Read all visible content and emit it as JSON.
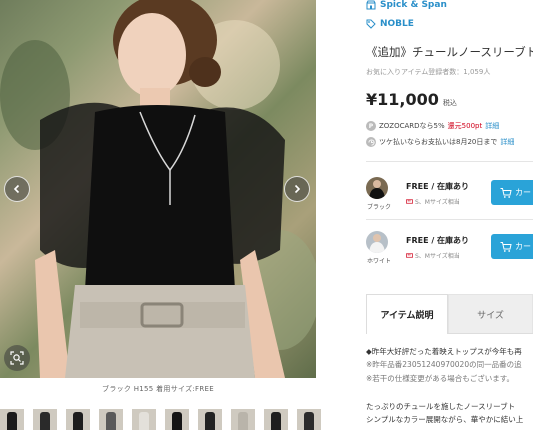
{
  "gallery": {
    "caption": "ブラック H155 着用サイズ:FREE",
    "thumb_count": 10,
    "thumb_colors": [
      "#1b1b1b",
      "#2a2a2a",
      "#1d1d1d",
      "#5a5a5a",
      "#e3e0da",
      "#151515",
      "#222222",
      "#b9b4aa",
      "#1e1e1e",
      "#2b2b2b"
    ]
  },
  "product": {
    "brand": "Spick & Span",
    "shop": "NOBLE",
    "title": "《追加》チュールノースリーブト",
    "favorites": "お気に入りアイテム登録者数：1,059人",
    "price": "¥11,000",
    "tax_label": "税込",
    "promo_zozocard_prefix": "ZOZOCARDなら5%",
    "promo_zozocard_points": "還元500pt",
    "promo_zozocard_link": "詳細",
    "promo_tsuke": "ツケ払いならお支払いは8月20日まで",
    "promo_tsuke_link": "詳細",
    "zozocard_icon_letter": "P"
  },
  "variants": [
    {
      "color_name": "ブラック",
      "stock": "FREE / 在庫あり",
      "size_note": "S、Mサイズ相当",
      "cart_label": "カー"
    },
    {
      "color_name": "ホワイト",
      "stock": "FREE / 在庫あり",
      "size_note": "S、Mサイズ相当",
      "cart_label": "カー"
    }
  ],
  "tabs": [
    {
      "label": "アイテム説明",
      "active": true
    },
    {
      "label": "サイズ",
      "active": false
    }
  ],
  "description": {
    "line1": "◆昨年大好評だった着映えトップスが今年も再",
    "line2": "※昨年品番23051240970020の同一品番の追",
    "line3": "※若干の仕様変更がある場合もございます。",
    "line4": "たっぷりのチュールを施したノースリーブト",
    "line5": "シンプルなカラー展開ながら、華やかに結い上"
  },
  "colors": {
    "accent": "#2a8fc9",
    "cart": "#2aa3d8",
    "points_red": "#d0021b"
  }
}
